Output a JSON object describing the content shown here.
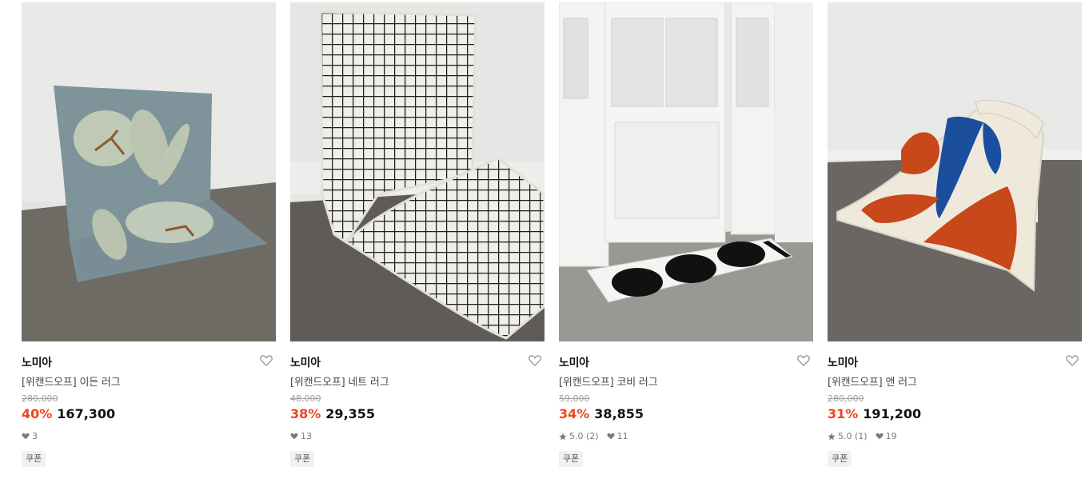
{
  "products": [
    {
      "brand": "노미아",
      "name": "[위캔드오프] 이든 러그",
      "original_price": "280,000",
      "discount": "40%",
      "price": "167,300",
      "rating": "",
      "likes": "3",
      "badge": "쿠폰",
      "icons": {
        "wishlist": "heart-outline-icon",
        "likes": "heart-filled-icon",
        "rating": "star-icon"
      }
    },
    {
      "brand": "노미아",
      "name": "[위캔드오프] 네트 러그",
      "original_price": "48,000",
      "discount": "38%",
      "price": "29,355",
      "rating": "",
      "likes": "13",
      "badge": "쿠폰",
      "icons": {
        "wishlist": "heart-outline-icon",
        "likes": "heart-filled-icon",
        "rating": "star-icon"
      }
    },
    {
      "brand": "노미아",
      "name": "[위캔드오프] 코비 러그",
      "original_price": "59,000",
      "discount": "34%",
      "price": "38,855",
      "rating": "5.0 (2)",
      "likes": "11",
      "badge": "쿠폰",
      "icons": {
        "wishlist": "heart-outline-icon",
        "likes": "heart-filled-icon",
        "rating": "star-icon"
      }
    },
    {
      "brand": "노미아",
      "name": "[위캔드오프] 앤 러그",
      "original_price": "280,000",
      "discount": "31%",
      "price": "191,200",
      "rating": "5.0 (1)",
      "likes": "19",
      "badge": "쿠폰",
      "icons": {
        "wishlist": "heart-outline-icon",
        "likes": "heart-filled-icon",
        "rating": "star-icon"
      }
    }
  ],
  "colors": {
    "discount": "#f0441c",
    "original_price": "#a0a0a0",
    "meta": "#7a7a7a",
    "badge_bg": "#f1f1f1"
  }
}
